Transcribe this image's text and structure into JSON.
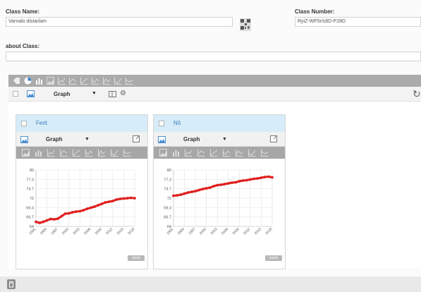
{
  "form": {
    "class_name_label": "Class Name:",
    "class_name_value": "Varnalo distarlam",
    "class_number_label": "Class Number:",
    "class_number_value": "RyiZ-WF5r/s8D-P28D",
    "about_label": "about Class:",
    "about_value": ""
  },
  "toolbar": {
    "chart_types": [
      "line",
      "pie",
      "bar",
      "area",
      "line",
      "line",
      "line",
      "line",
      "line",
      "line",
      "line"
    ]
  },
  "subbar": {
    "mode_label": "Graph"
  },
  "panels": [
    {
      "title": "Ferit",
      "mode_label": "Graph",
      "zoom_label": "zoom"
    },
    {
      "title": "Nô",
      "mode_label": "Graph",
      "zoom_label": "zoom"
    }
  ],
  "chart_data": [
    {
      "type": "line",
      "series": [
        {
          "color": "#e02020",
          "x": [
            1991,
            1992,
            1993,
            1994,
            1995,
            1996,
            1997,
            1998,
            1999,
            2000,
            2001,
            2002,
            2003,
            2004,
            2005,
            2006,
            2007,
            2008,
            2009,
            2010,
            2011,
            2012,
            2013,
            2014,
            2015,
            2016,
            2017,
            2018
          ],
          "values": [
            65.3,
            65.0,
            65.3,
            65.7,
            66.1,
            66.0,
            66.2,
            66.9,
            67.6,
            67.7,
            68.0,
            68.2,
            68.3,
            68.6,
            69.0,
            69.3,
            69.6,
            70.0,
            70.4,
            70.8,
            71.0,
            71.2,
            71.6,
            71.8,
            71.9,
            72.0,
            72.1,
            72.0
          ]
        }
      ],
      "x_ticks": [
        "1991",
        "1994",
        "1997",
        "2000",
        "2003",
        "2006",
        "2009",
        "2012",
        "2015",
        "2018"
      ],
      "y_ticks": [
        "64",
        "66.7",
        "69.3",
        "72",
        "74.7",
        "77.3",
        "80"
      ],
      "ylim": [
        64,
        80
      ],
      "grid": true
    },
    {
      "type": "line",
      "series": [
        {
          "color": "#e02020",
          "x": [
            1991,
            1992,
            1993,
            1994,
            1995,
            1996,
            1997,
            1998,
            1999,
            2000,
            2001,
            2002,
            2003,
            2004,
            2005,
            2006,
            2007,
            2008,
            2009,
            2010,
            2011,
            2012,
            2013,
            2014,
            2015,
            2016,
            2017,
            2018
          ],
          "values": [
            72.7,
            72.8,
            73.0,
            73.3,
            73.6,
            73.8,
            74.0,
            74.3,
            74.6,
            74.8,
            75.0,
            75.4,
            75.7,
            75.8,
            76.0,
            76.2,
            76.4,
            76.5,
            76.8,
            77.0,
            77.1,
            77.3,
            77.5,
            77.6,
            77.8,
            78.0,
            78.1,
            77.9
          ]
        }
      ],
      "x_ticks": [
        "1991",
        "1994",
        "1997",
        "2000",
        "2003",
        "2006",
        "2009",
        "2012",
        "2015",
        "2018"
      ],
      "y_ticks": [
        "64",
        "66.7",
        "69.3",
        "72",
        "74.7",
        "77.3",
        "80"
      ],
      "ylim": [
        64,
        80
      ],
      "grid": true
    }
  ]
}
